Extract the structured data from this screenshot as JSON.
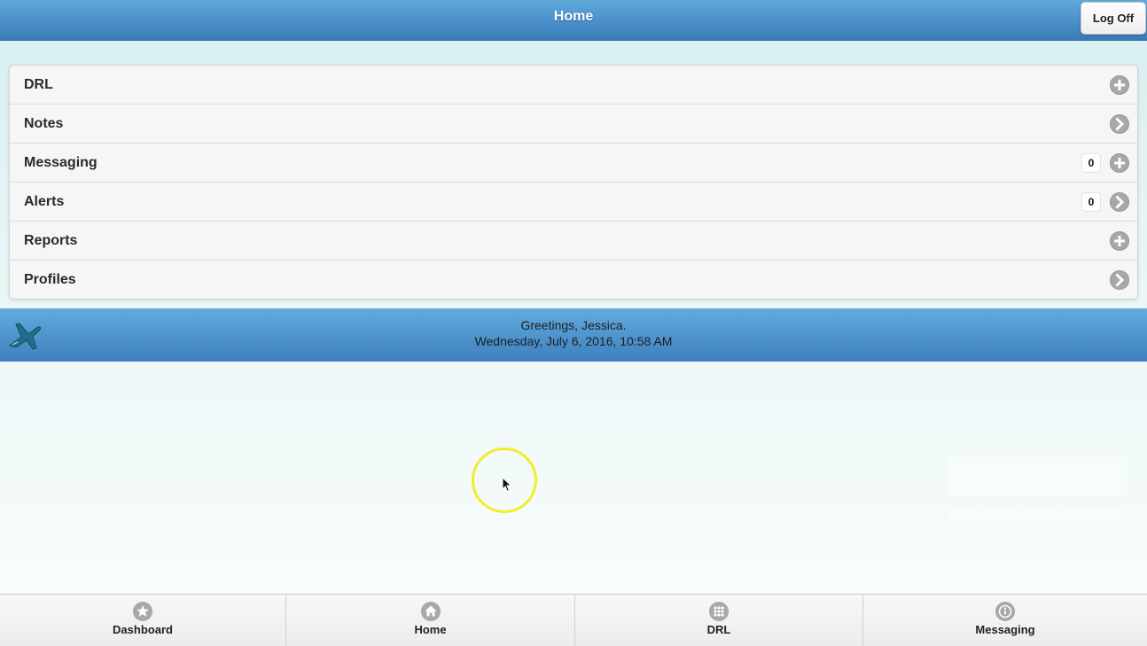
{
  "header": {
    "title": "Home",
    "logoff_label": "Log Off"
  },
  "menu": {
    "items": [
      {
        "label": "DRL",
        "icon": "plus-icon",
        "count": null
      },
      {
        "label": "Notes",
        "icon": "chevron-right-icon",
        "count": null
      },
      {
        "label": "Messaging",
        "icon": "plus-icon",
        "count": "0"
      },
      {
        "label": "Alerts",
        "icon": "chevron-right-icon",
        "count": "0"
      },
      {
        "label": "Reports",
        "icon": "plus-icon",
        "count": null
      },
      {
        "label": "Profiles",
        "icon": "chevron-right-icon",
        "count": null
      }
    ]
  },
  "banner": {
    "greeting": "Greetings, Jessica.",
    "datetime": "Wednesday, July 6, 2016, 10:58 AM",
    "logo_icon": "airplane-icon"
  },
  "footer": {
    "tabs": [
      {
        "label": "Dashboard",
        "icon": "star-icon"
      },
      {
        "label": "Home",
        "icon": "home-icon"
      },
      {
        "label": "DRL",
        "icon": "grid-icon"
      },
      {
        "label": "Messaging",
        "icon": "info-icon"
      }
    ]
  },
  "colors": {
    "header_blue": "#4a8fca",
    "icon_gray": "#a8a8a8",
    "cursor_highlight": "#f0ef2a"
  }
}
